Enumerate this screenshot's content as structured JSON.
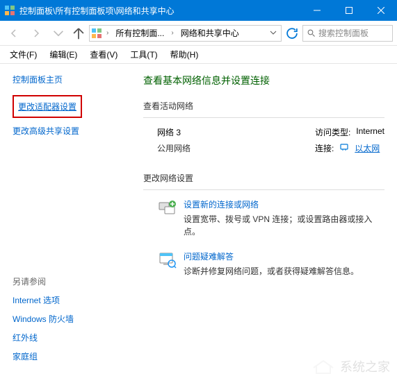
{
  "titlebar": {
    "title": "控制面板\\所有控制面板项\\网络和共享中心"
  },
  "address": {
    "crumb1": "所有控制面...",
    "crumb2": "网络和共享中心",
    "search_placeholder": "搜索控制面板"
  },
  "menu": {
    "file": "文件(F)",
    "edit": "编辑(E)",
    "view": "查看(V)",
    "tools": "工具(T)",
    "help": "帮助(H)"
  },
  "sidebar": {
    "cphome": "控制面板主页",
    "change_adapter": "更改适配器设置",
    "advanced_sharing": "更改高级共享设置",
    "seealso_head": "另请参阅",
    "seealso": {
      "internet_options": "Internet 选项",
      "firewall": "Windows 防火墙",
      "infrared": "红外线",
      "homegroup": "家庭组"
    }
  },
  "main": {
    "h1": "查看基本网络信息并设置连接",
    "active_networks": "查看活动网络",
    "network": {
      "name": "网络  3",
      "type": "公用网络",
      "access_label": "访问类型:",
      "access_value": "Internet",
      "conn_label": "连接:",
      "conn_value": "以太网"
    },
    "change_settings": "更改网络设置",
    "task1": {
      "title": "设置新的连接或网络",
      "desc": "设置宽带、拨号或 VPN 连接；或设置路由器或接入点。"
    },
    "task2": {
      "title": "问题疑难解答",
      "desc": "诊断并修复网络问题，或者获得疑难解答信息。"
    }
  },
  "watermark": "系统之家"
}
